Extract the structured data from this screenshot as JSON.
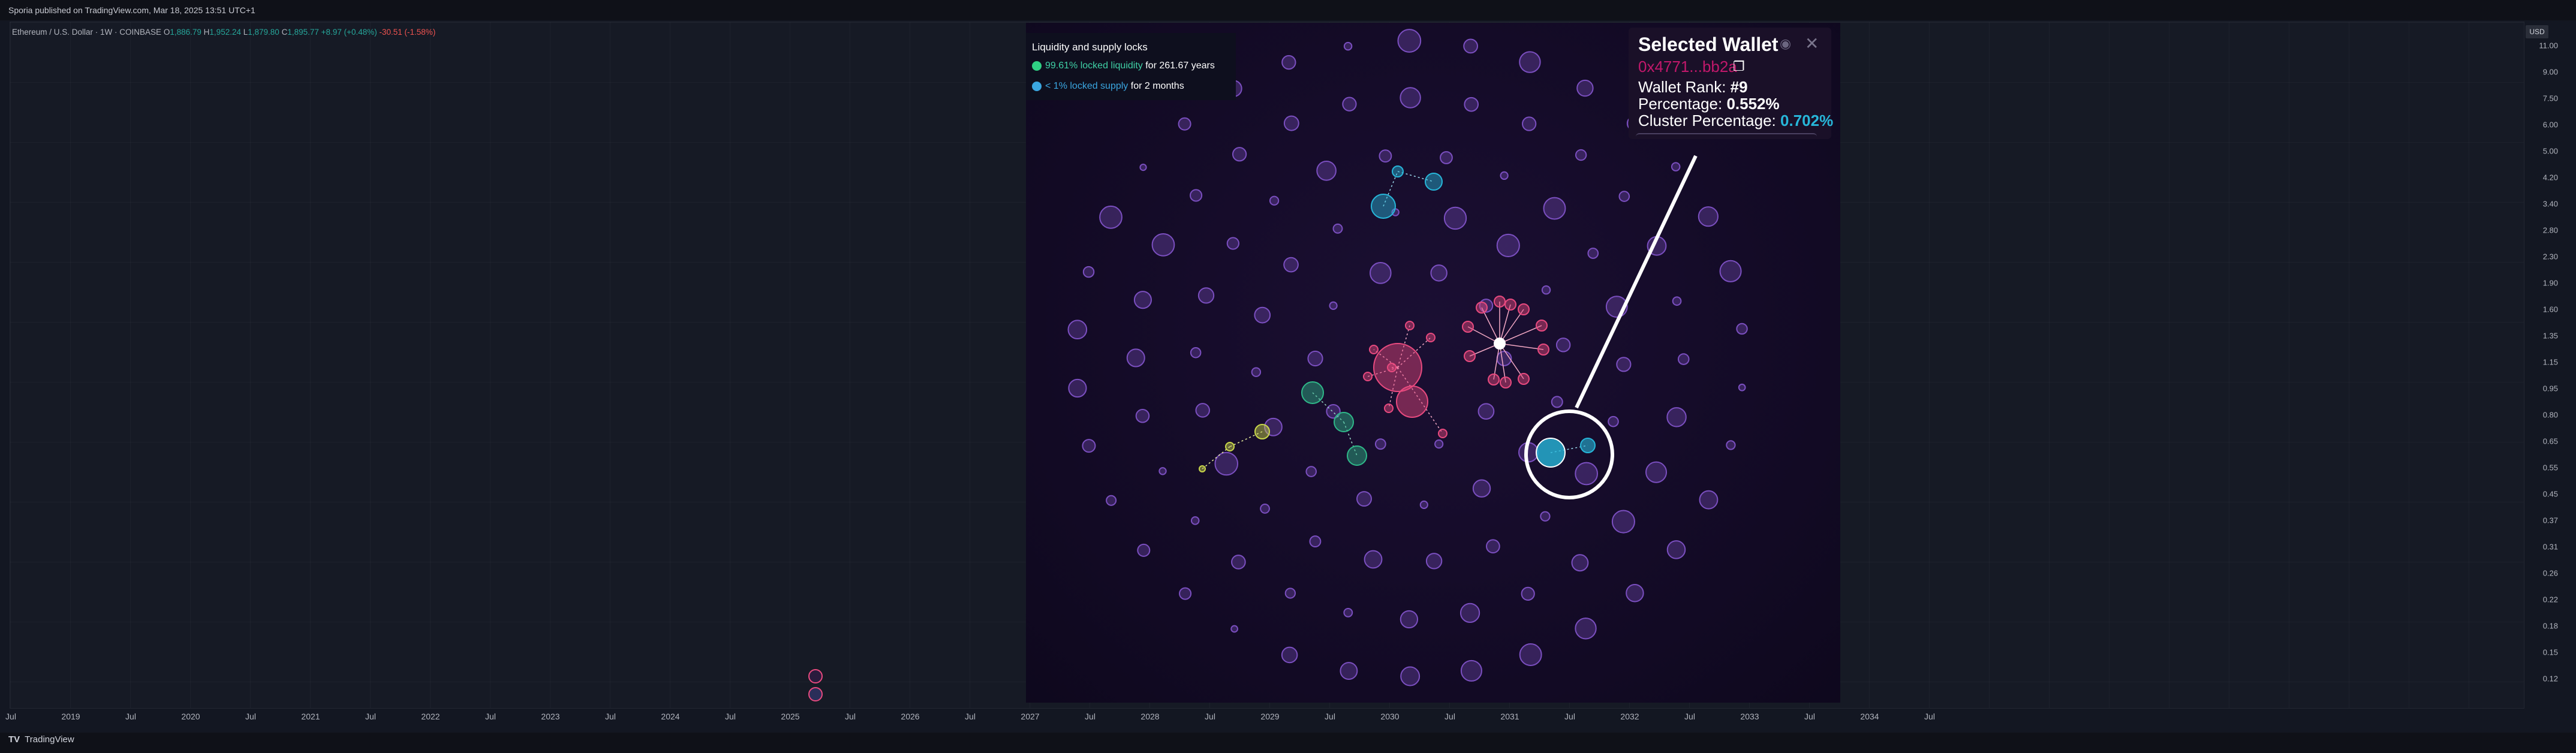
{
  "header": {
    "publish_text": "Sporia published on TradingView.com, Mar 18, 2025 13:51 UTC+1"
  },
  "legend": {
    "symbol": "Ethereum / U.S. Dollar · 1W · COINBASE",
    "open_label": "O",
    "open": "1,886.79",
    "high_label": "H",
    "high": "1,952.24",
    "low_label": "L",
    "low": "1,879.80",
    "close_label": "C",
    "close": "1,895.77",
    "change": "+8.97 (+0.48%)",
    "extra": "-30.51 (-1.58%)"
  },
  "price_axis": {
    "currency": "USD",
    "ticks": [
      "11.00",
      "9.00",
      "7.50",
      "6.00",
      "5.00",
      "4.20",
      "3.40",
      "2.80",
      "2.30",
      "1.90",
      "1.60",
      "1.35",
      "1.15",
      "0.95",
      "0.80",
      "0.65",
      "0.55",
      "0.45",
      "0.37",
      "0.31",
      "0.26",
      "0.22",
      "0.18",
      "0.15",
      "0.12"
    ]
  },
  "time_axis": {
    "ticks": [
      "Jul",
      "2019",
      "Jul",
      "2020",
      "Jul",
      "2021",
      "Jul",
      "2022",
      "Jul",
      "2023",
      "Jul",
      "2024",
      "Jul",
      "2025",
      "Jul",
      "2026",
      "Jul",
      "2027",
      "Jul",
      "2028",
      "Jul",
      "2029",
      "Jul",
      "2030",
      "Jul",
      "2031",
      "Jul",
      "2032",
      "Jul",
      "2033",
      "Jul",
      "2034",
      "Jul"
    ]
  },
  "locks_panel": {
    "title": "Liquidity and supply locks",
    "liquidity_value": "99.61% locked liquidity",
    "liquidity_duration": "for 261.67 years",
    "supply_value": "< 1% locked supply",
    "supply_duration": "for 2 months"
  },
  "selected_wallet": {
    "title": "Selected Wallet",
    "address": "0x4771...bb2a",
    "rank_label": "Wallet Rank:",
    "rank_value": "#9",
    "percentage_label": "Percentage:",
    "percentage_value": "0.552%",
    "cluster_label": "Cluster Percentage:",
    "cluster_value": "0.702%"
  },
  "footer": {
    "brand": "TradingView"
  },
  "colors": {
    "accent_pink": "#e84a7f",
    "accent_cyan": "#27b6d9",
    "accent_green": "#2fb889",
    "accent_yellow": "#c9d84a",
    "bubble_purple": "#7b4fc0"
  }
}
